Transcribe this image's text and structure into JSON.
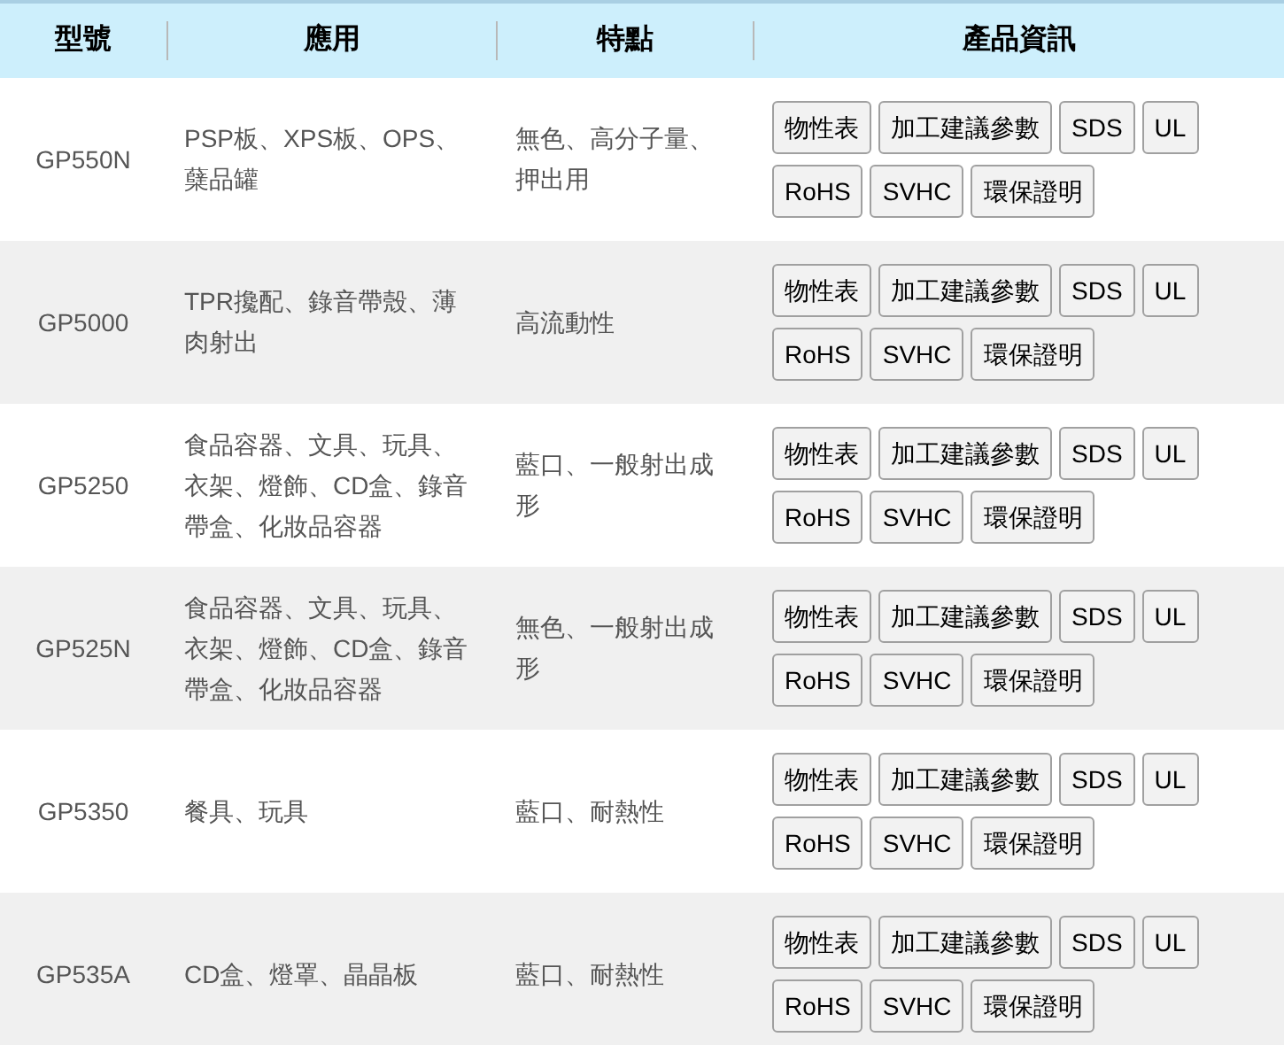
{
  "table": {
    "columns": [
      "型號",
      "應用",
      "特點",
      "產品資訊"
    ],
    "rows": [
      {
        "model": "GP550N",
        "application": "PSP板、XPS板、OPS、蘖品罐",
        "features": "無色、高分子量、押出用",
        "buttons": [
          "物性表",
          "加工建議參數",
          "SDS",
          "UL",
          "RoHS",
          "SVHC",
          "環保證明"
        ]
      },
      {
        "model": "GP5000",
        "application": "TPR攙配、錄音帶殼、薄肉射出",
        "features": "高流動性",
        "buttons": [
          "物性表",
          "加工建議參數",
          "SDS",
          "UL",
          "RoHS",
          "SVHC",
          "環保證明"
        ]
      },
      {
        "model": "GP5250",
        "application": "食品容器、文具、玩具、衣架、燈飾、CD盒、錄音帶盒、化妝品容器",
        "features": "藍口、一般射出成形",
        "buttons": [
          "物性表",
          "加工建議參數",
          "SDS",
          "UL",
          "RoHS",
          "SVHC",
          "環保證明"
        ]
      },
      {
        "model": "GP525N",
        "application": "食品容器、文具、玩具、衣架、燈飾、CD盒、錄音帶盒、化妝品容器",
        "features": "無色、一般射出成形",
        "buttons": [
          "物性表",
          "加工建議參數",
          "SDS",
          "UL",
          "RoHS",
          "SVHC",
          "環保證明"
        ]
      },
      {
        "model": "GP5350",
        "application": "餐具、玩具",
        "features": "藍口、耐熱性",
        "buttons": [
          "物性表",
          "加工建議參數",
          "SDS",
          "UL",
          "RoHS",
          "SVHC",
          "環保證明"
        ]
      },
      {
        "model": "GP535A",
        "application": "CD盒、燈罩、晶晶板",
        "features": "藍口、耐熱性",
        "buttons": [
          "物性表",
          "加工建議參數",
          "SDS",
          "UL",
          "RoHS",
          "SVHC",
          "環保證明"
        ]
      }
    ]
  }
}
